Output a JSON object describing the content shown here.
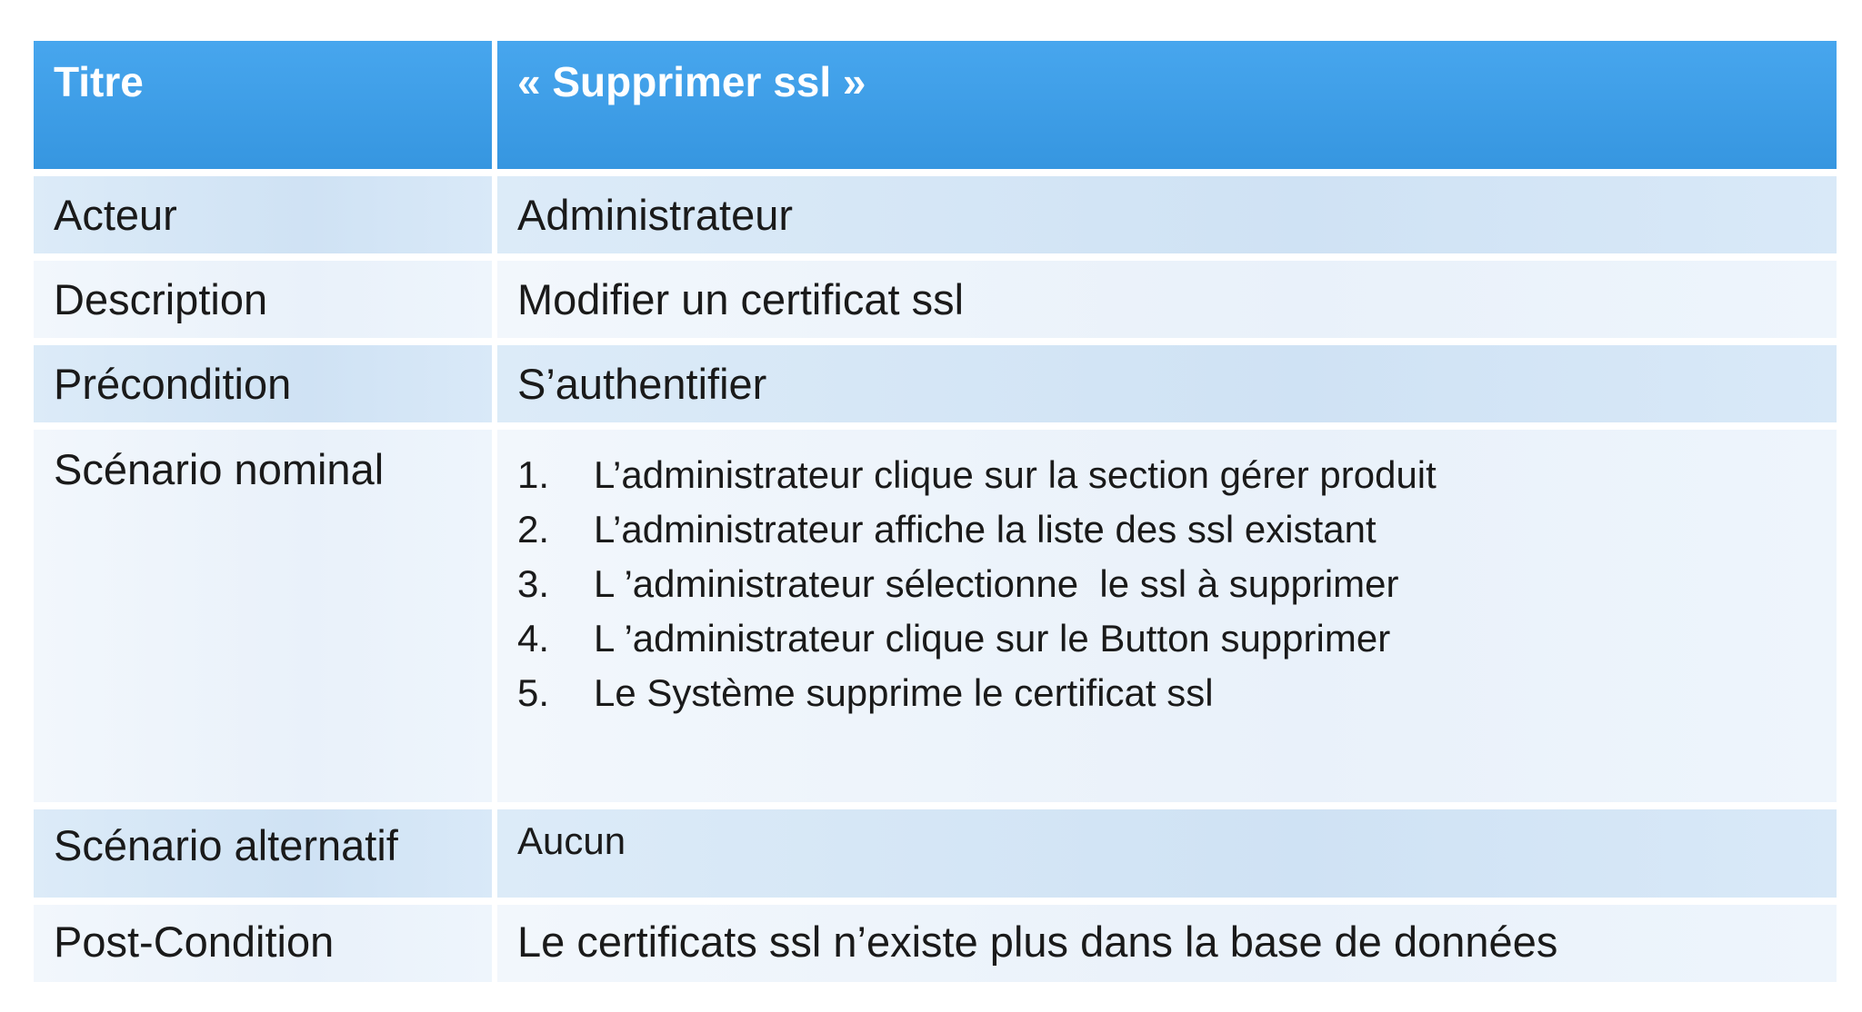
{
  "table": {
    "header": {
      "label": "Titre",
      "value": "« Supprimer ssl »"
    },
    "rows": {
      "acteur": {
        "label": "Acteur",
        "value": "Administrateur"
      },
      "description": {
        "label": "Description",
        "value": "Modifier un certificat ssl"
      },
      "precondition": {
        "label": "Précondition",
        "value": "S’authentifier"
      },
      "scenario_nominal": {
        "label": "Scénario nominal",
        "steps": [
          {
            "num": "1.",
            "text": "L’administrateur clique sur la section gérer produit"
          },
          {
            "num": "2.",
            "text": "L’administrateur affiche la liste des ssl existant"
          },
          {
            "num": "3.",
            "text": "L ’administrateur sélectionne  le ssl à supprimer"
          },
          {
            "num": "4.",
            "text": "L ’administrateur clique sur le Button supprimer"
          },
          {
            "num": "5.",
            "text": "Le Système supprime le certificat ssl"
          }
        ]
      },
      "scenario_alternatif": {
        "label": "Scénario alternatif",
        "value": "Aucun"
      },
      "post_condition": {
        "label": "Post-Condition",
        "value": "Le certificats ssl n’existe plus dans la base de données"
      }
    }
  },
  "colors": {
    "header_bg": "#3d9ee7",
    "row_dark": "#d5e7f7",
    "row_light": "#ecf3fb"
  }
}
